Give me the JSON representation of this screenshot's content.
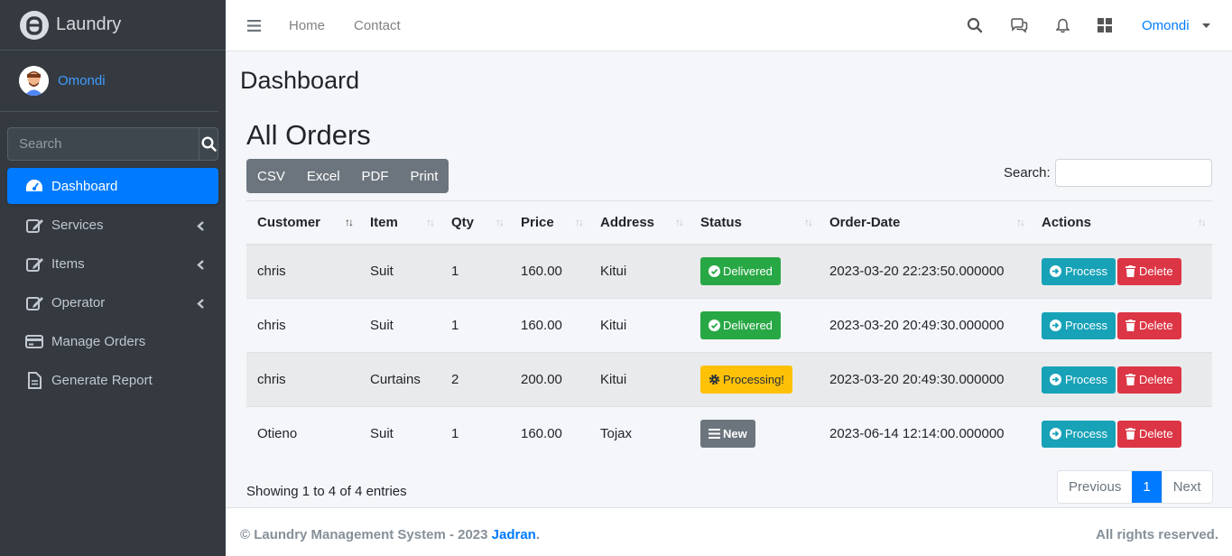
{
  "brand": {
    "name": "Laundry"
  },
  "user": {
    "name": "Omondi"
  },
  "sidebar_search": {
    "placeholder": "Search"
  },
  "nav": [
    {
      "label": "Dashboard",
      "icon": "dashboard-icon",
      "active": true
    },
    {
      "label": "Services",
      "icon": "edit-icon",
      "submenu": true
    },
    {
      "label": "Items",
      "icon": "edit-icon",
      "submenu": true
    },
    {
      "label": "Operator",
      "icon": "edit-icon",
      "submenu": true
    },
    {
      "label": "Manage Orders",
      "icon": "credit-card-icon"
    },
    {
      "label": "Generate Report",
      "icon": "file-icon"
    }
  ],
  "topbar": {
    "home": "Home",
    "contact": "Contact",
    "user": "Omondi"
  },
  "page_title": "Dashboard",
  "section_title": "All Orders",
  "export_buttons": [
    "CSV",
    "Excel",
    "PDF",
    "Print"
  ],
  "table_search_label": "Search:",
  "table": {
    "columns": [
      "Customer",
      "Item",
      "Qty",
      "Price",
      "Address",
      "Status",
      "Order-Date",
      "Actions"
    ],
    "rows": [
      {
        "customer": "chris",
        "item": "Suit",
        "qty": "1",
        "price": "160.00",
        "address": "Kitui",
        "status": "Delivered",
        "date": "2023-03-20 22:23:50.000000"
      },
      {
        "customer": "chris",
        "item": "Suit",
        "qty": "1",
        "price": "160.00",
        "address": "Kitui",
        "status": "Delivered",
        "date": "2023-03-20 20:49:30.000000"
      },
      {
        "customer": "chris",
        "item": "Curtains",
        "qty": "2",
        "price": "200.00",
        "address": "Kitui",
        "status": "Processing!",
        "date": "2023-03-20 20:49:30.000000"
      },
      {
        "customer": "Otieno",
        "item": "Suit",
        "qty": "1",
        "price": "160.00",
        "address": "Tojax",
        "status": "New",
        "date": "2023-06-14 12:14:00.000000"
      }
    ],
    "process_label": "Process",
    "delete_label": "Delete"
  },
  "showing": "Showing 1 to 4 of 4 entries",
  "pagination": {
    "previous": "Previous",
    "current": "1",
    "next": "Next"
  },
  "footer": {
    "left_prefix": "© Laundry Management System - 2023",
    "link": "Jadran",
    "left_suffix": ".",
    "right": "All rights reserved."
  },
  "colors": {
    "primary": "#007bff",
    "sidebar": "#343a40",
    "success": "#28a745",
    "warning": "#ffc107",
    "info": "#17a2b8",
    "danger": "#dc3545"
  }
}
